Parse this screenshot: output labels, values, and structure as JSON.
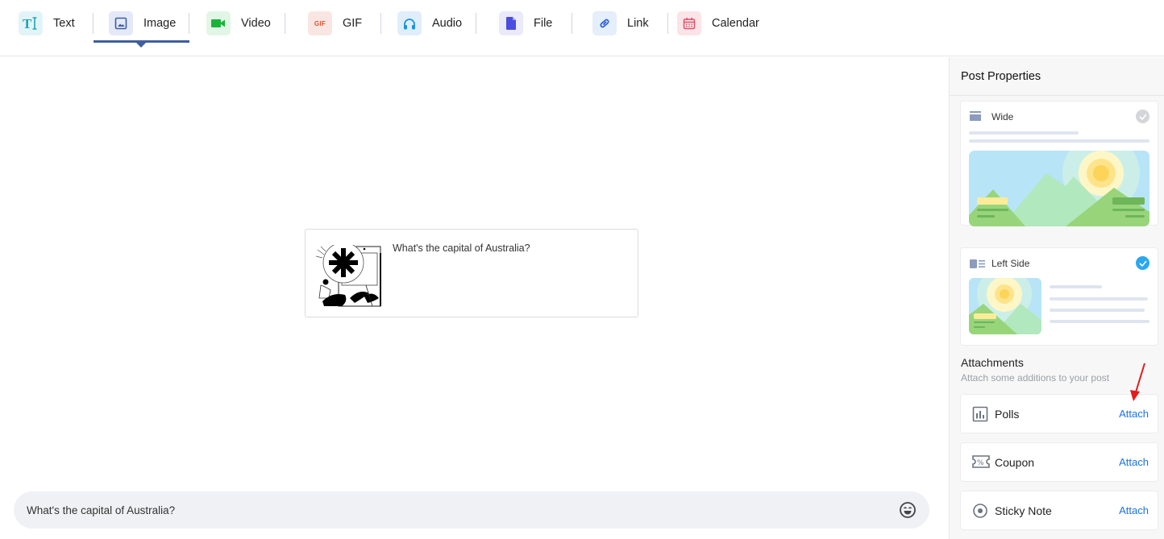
{
  "tabs": [
    {
      "label": "Text",
      "icon": "text-icon",
      "active": false
    },
    {
      "label": "Image",
      "icon": "image-icon",
      "active": true
    },
    {
      "label": "Video",
      "icon": "video-icon",
      "active": false
    },
    {
      "label": "GIF",
      "icon": "gif-icon",
      "active": false
    },
    {
      "label": "Audio",
      "icon": "headphones-icon",
      "active": false
    },
    {
      "label": "File",
      "icon": "file-icon",
      "active": false
    },
    {
      "label": "Link",
      "icon": "link-icon",
      "active": false
    },
    {
      "label": "Calendar",
      "icon": "calendar-icon",
      "active": false
    }
  ],
  "gif_glyph": "GIF",
  "preview": {
    "text": "What's the capital of Australia?"
  },
  "composer": {
    "value": "What's the capital of Australia?",
    "emoji_icon": "smiley-icon"
  },
  "sidebar": {
    "title": "Post Properties",
    "layouts": [
      {
        "name": "Wide",
        "selected": false
      },
      {
        "name": "Left Side",
        "selected": true
      }
    ],
    "attachments": {
      "title": "Attachments",
      "subtitle": "Attach some additions to your post",
      "items": [
        {
          "label": "Polls",
          "action": "Attach",
          "icon": "poll-chart-icon"
        },
        {
          "label": "Coupon",
          "action": "Attach",
          "icon": "coupon-icon"
        },
        {
          "label": "Sticky Note",
          "action": "Attach",
          "icon": "radio-dot-icon"
        }
      ]
    }
  },
  "colors": {
    "accent": "#3f5e9c",
    "link": "#1a73e8",
    "selected_check": "#29a8f0",
    "annotation_arrow": "#e31b1b"
  }
}
